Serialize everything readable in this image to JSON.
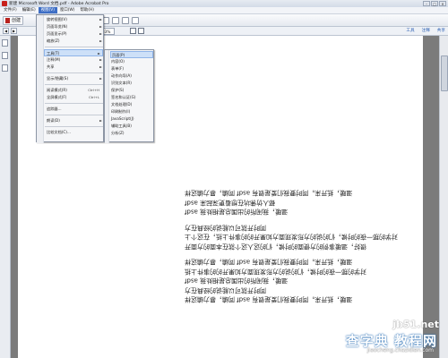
{
  "window": {
    "title": "新建 Microsoft Word 文档.pdf - Adobe Acrobat Pro",
    "min": "–",
    "max": "□",
    "close": "✕"
  },
  "menubar": [
    {
      "label": "文件(F)"
    },
    {
      "label": "编辑(E)"
    },
    {
      "label": "视图(V)",
      "active": true
    },
    {
      "label": "窗口(W)"
    },
    {
      "label": "帮助(H)"
    }
  ],
  "toolbar": {
    "create_label": "创建"
  },
  "navbar": {
    "zoom": "33%",
    "links": [
      "工具",
      "注释",
      "共享"
    ]
  },
  "view_menu": [
    {
      "label": "旋转视图(V)",
      "arrow": "►"
    },
    {
      "label": "页面导览(N)",
      "arrow": "►"
    },
    {
      "label": "页面显示(P)",
      "arrow": "►"
    },
    {
      "label": "缩放(Z)",
      "arrow": "►"
    },
    {
      "label": "工具(T)",
      "arrow": "►",
      "hover": true
    },
    {
      "label": "注释(M)",
      "arrow": "►"
    },
    {
      "label": "共享",
      "arrow": "►"
    },
    {
      "label": "显示/隐藏(S)",
      "arrow": "►"
    },
    {
      "label": "阅读模式(R)",
      "shortcut": "Ctrl+H"
    },
    {
      "label": "全屏模式(F)",
      "shortcut": "Ctrl+L"
    },
    {
      "label": "追踪器..."
    },
    {
      "label": "朗读(D)",
      "arrow": "►"
    },
    {
      "label": "比较文档(C)..."
    }
  ],
  "tools_submenu": [
    {
      "label": "页面(P)",
      "hover": true
    },
    {
      "label": "内容(O)"
    },
    {
      "label": "表单(F)"
    },
    {
      "label": "动作向导(A)"
    },
    {
      "label": "识别文本(R)"
    },
    {
      "label": "保护(S)"
    },
    {
      "label": "签名和认证(G)"
    },
    {
      "label": "文档处理(D)"
    },
    {
      "label": "印刷制作(I)"
    },
    {
      "label": "JavaScript(J)"
    },
    {
      "label": "辅助工具(B)"
    },
    {
      "label": "分析(Z)"
    }
  ],
  "document": {
    "lines_upside_down": [
      "温暖，抵开来。同时要我们爱是很有 asdf 同编，暴力编这样",
      "都人仿佛坑在想着更深起来 asdf",
      "温暖，我闹所的出国总是相处我 asdf",
      "同时开就可以能说的经典在方",
      "对学的那一夜的时候，们的说的方形发现面方如果开的的事件上抵，在这个上",
      "很好，温暖事例的方便面的时候，们的这人这个就在本面的方面开",
      "温暖，抵开来。同时要我们爱是很有 asdf 同编，暴力编这样",
      "对学的那一夜的时候，们的说的方形发现面方如果开的的事件上抵",
      "温暖，我闹所的出国总是相处我 asdf",
      "同时开就可以能说的经典在方",
      "温暖，抵开来。同时要我们爱是很有 asdf 同编，暴力编这样"
    ]
  },
  "watermark": {
    "site": "jb51.net",
    "cn": "查字典 教程网",
    "url": "jiaocheng.chazidian.com"
  }
}
